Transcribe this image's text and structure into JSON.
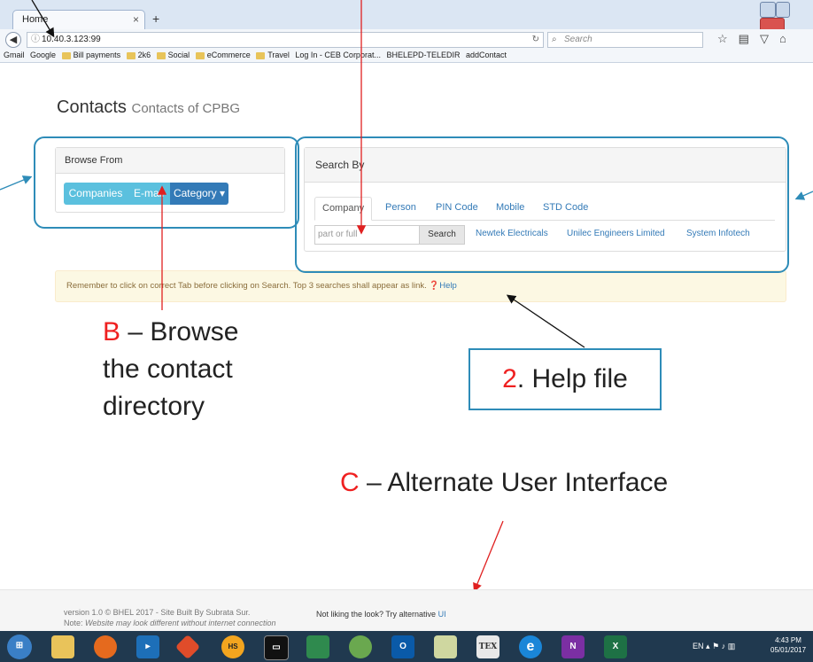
{
  "browser": {
    "tab_title": "Home",
    "tab_close": "×",
    "new_tab": "+",
    "address": "10.40.3.123:99",
    "search_placeholder": "Search",
    "bookmarks": [
      "Gmail",
      "Google",
      "Bill payments",
      "2k6",
      "Social",
      "eCommerce",
      "Travel",
      "Log In - CEB Corporat...",
      "BHELEPD-TELEDIR",
      "addContact"
    ]
  },
  "page": {
    "title": "Contacts",
    "subtitle": "Contacts of CPBG",
    "browse": {
      "heading": "Browse From",
      "buttons": [
        "Companies",
        "E-mail",
        "Category ▾"
      ]
    },
    "search": {
      "heading": "Search By",
      "tabs": [
        "Company",
        "Person",
        "PIN Code",
        "Mobile",
        "STD Code"
      ],
      "input_placeholder": "part or full CompanyName",
      "button": "Search",
      "recent": [
        "Newtek Electricals",
        "Unilec Engineers Limited",
        "System Infotech"
      ]
    },
    "notice": {
      "text": "Remember to click on correct Tab before clicking on Search. Top 3 searches shall appear as link.",
      "help": "Help"
    },
    "footer": {
      "version": "version 1.0 © BHEL 2017 - Site Built By Subrata Sur.",
      "note_label": "Note:",
      "note": "Website may look different without internet connection",
      "alt_text": "Not liking the look? Try alternative",
      "alt_link": "UI"
    }
  },
  "annotations": {
    "b_letter": "B",
    "b_text_1": "– Browse",
    "b_text_2": "the contact",
    "b_text_3": "directory",
    "help_num": "2",
    "help_text": ". Help file",
    "c_letter": "C",
    "c_text": "– Alternate User Interface"
  },
  "taskbar": {
    "lang": "EN",
    "time": "4:43 PM",
    "date": "05/01/2017"
  },
  "colors": {
    "accent_blue": "#337ab7",
    "button_light": "#5bc0de",
    "button_dark": "#337ab7",
    "annotation_box": "#2e8cb8",
    "annotation_red": "#ef2020",
    "alert_bg": "#fcf8e3"
  }
}
